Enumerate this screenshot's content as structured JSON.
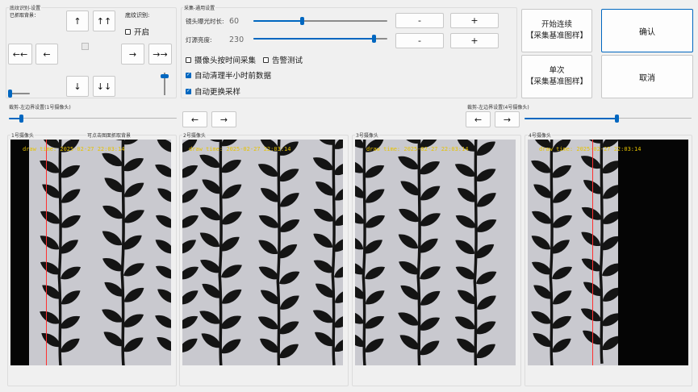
{
  "pattern_group": {
    "title": "底纹识别-设置",
    "captured_label": "已抓取背景：",
    "detect_label": "底纹识别:",
    "enable_label": "开启",
    "enable_checked": false
  },
  "arrows": {
    "up": "↑",
    "up_double": "↑↑",
    "left_double": "←←",
    "left": "←",
    "right": "→",
    "right_double": "→→",
    "down": "↓",
    "down_double": "↓↓"
  },
  "capture_group": {
    "title": "采集-通用设置",
    "exposure_label": "镜头曝光时长:",
    "exposure_value": "60",
    "brightness_label": "灯源亮度:",
    "brightness_value": "230",
    "minus": "-",
    "plus": "+",
    "timed_capture_label": "摄像头按时间采集",
    "timed_capture_checked": false,
    "alarm_test_label": "告警测试",
    "alarm_test_checked": false,
    "auto_clean_label": "自动清理半小时前数据",
    "auto_clean_checked": true,
    "auto_replace_label": "自动更换采样",
    "auto_replace_checked": true
  },
  "actions": {
    "start_continuous_line1": "开始连续",
    "start_continuous_line2": "【采集基准图样】",
    "single_line1": "单次",
    "single_line2": "【采集基准图样】",
    "confirm": "确认",
    "cancel": "取消"
  },
  "crop_left": {
    "title": "裁剪-左边界设置(1号摄像头)",
    "left_btn": "←",
    "right_btn": "→"
  },
  "crop_right": {
    "title": "裁剪-左边界设置(4号摄像头)",
    "left_btn": "←",
    "right_btn": "→"
  },
  "cameras": [
    {
      "title": "1号摄像头",
      "hint": "可点击图面抓取背景",
      "timestamp": "draw time: 2025-02-27 22:03:14"
    },
    {
      "title": "2号摄像头",
      "timestamp": "draw time: 2025-02-27 22:03:14"
    },
    {
      "title": "3号摄像头",
      "timestamp": "draw time: 2025-02-27 22:03:14"
    },
    {
      "title": "4号摄像头",
      "timestamp": "draw time: 2025-02-27 22:03:14"
    }
  ],
  "colors": {
    "accent": "#0067c0",
    "fabric": "#c9c9cf",
    "leaf": "#141414",
    "timestamp": "#e6c200",
    "crop_line": "#ff3030"
  },
  "sliders": {
    "exposure_fraction": 0.36,
    "brightness_fraction": 0.9,
    "crop_left_fraction": 0.07,
    "crop_right_fraction": 0.55,
    "pattern_h_fraction": 0.05,
    "pattern_v_fraction": 0.92
  }
}
